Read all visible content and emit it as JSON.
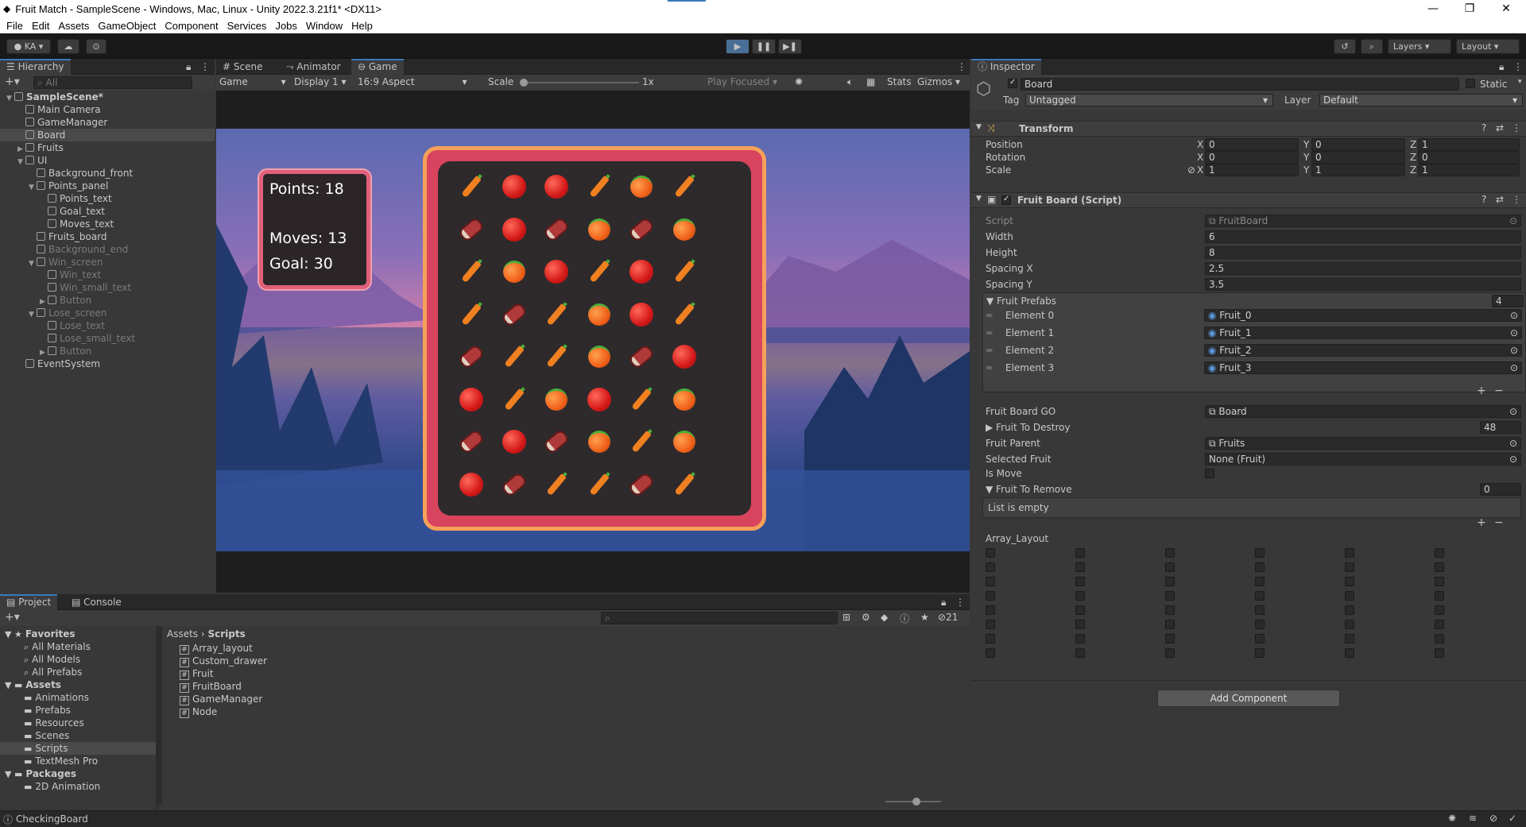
{
  "window": {
    "title": "Fruit Match - SampleScene - Windows, Mac, Linux - Unity 2022.3.21f1* <DX11>"
  },
  "menu": [
    "File",
    "Edit",
    "Assets",
    "GameObject",
    "Component",
    "Services",
    "Jobs",
    "Window",
    "Help"
  ],
  "toolbar": {
    "account": "KA",
    "layers": "Layers",
    "layout": "Layout"
  },
  "hierarchy": {
    "tab": "Hierarchy",
    "search_placeholder": "All",
    "items": [
      {
        "label": "SampleScene*",
        "indent": 0,
        "arrow": "▼",
        "dim": false
      },
      {
        "label": "Main Camera",
        "indent": 1,
        "arrow": "",
        "dim": false
      },
      {
        "label": "GameManager",
        "indent": 1,
        "arrow": "",
        "dim": false
      },
      {
        "label": "Board",
        "indent": 1,
        "arrow": "",
        "dim": false
      },
      {
        "label": "Fruits",
        "indent": 1,
        "arrow": "▶",
        "dim": false
      },
      {
        "label": "UI",
        "indent": 1,
        "arrow": "▼",
        "dim": false
      },
      {
        "label": "Background_front",
        "indent": 2,
        "arrow": "",
        "dim": false
      },
      {
        "label": "Points_panel",
        "indent": 2,
        "arrow": "▼",
        "dim": false
      },
      {
        "label": "Points_text",
        "indent": 3,
        "arrow": "",
        "dim": false
      },
      {
        "label": "Goal_text",
        "indent": 3,
        "arrow": "",
        "dim": false
      },
      {
        "label": "Moves_text",
        "indent": 3,
        "arrow": "",
        "dim": false
      },
      {
        "label": "Fruits_board",
        "indent": 2,
        "arrow": "",
        "dim": false
      },
      {
        "label": "Background_end",
        "indent": 2,
        "arrow": "",
        "dim": true
      },
      {
        "label": "Win_screen",
        "indent": 2,
        "arrow": "▼",
        "dim": true
      },
      {
        "label": "Win_text",
        "indent": 3,
        "arrow": "",
        "dim": true
      },
      {
        "label": "Win_small_text",
        "indent": 3,
        "arrow": "",
        "dim": true
      },
      {
        "label": "Button",
        "indent": 3,
        "arrow": "▶",
        "dim": true
      },
      {
        "label": "Lose_screen",
        "indent": 2,
        "arrow": "▼",
        "dim": true
      },
      {
        "label": "Lose_text",
        "indent": 3,
        "arrow": "",
        "dim": true
      },
      {
        "label": "Lose_small_text",
        "indent": 3,
        "arrow": "",
        "dim": true
      },
      {
        "label": "Button",
        "indent": 3,
        "arrow": "▶",
        "dim": true
      },
      {
        "label": "EventSystem",
        "indent": 1,
        "arrow": "",
        "dim": false
      }
    ]
  },
  "scene_tabs": {
    "scene": "Scene",
    "animator": "Animator",
    "game": "Game"
  },
  "game_bar": {
    "game": "Game",
    "display": "Display 1",
    "aspect": "16:9 Aspect",
    "scale_label": "Scale",
    "scale_value": "1x",
    "play_focused": "Play Focused",
    "stats": "Stats",
    "gizmos": "Gizmos"
  },
  "game_view": {
    "points": "Points: 18",
    "moves": "Moves: 13",
    "goal": "Goal: 30",
    "grid": [
      [
        "carrot",
        "apple",
        "apple",
        "carrot",
        "orange",
        "carrot"
      ],
      [
        "meat",
        "apple",
        "meat",
        "orange",
        "meat",
        "orange"
      ],
      [
        "carrot",
        "orange",
        "apple",
        "carrot",
        "apple",
        "carrot"
      ],
      [
        "carrot",
        "meat",
        "carrot",
        "orange",
        "apple",
        "carrot"
      ],
      [
        "meat",
        "carrot",
        "carrot",
        "orange",
        "meat",
        "apple"
      ],
      [
        "apple",
        "carrot",
        "orange",
        "apple",
        "carrot",
        "orange"
      ],
      [
        "meat",
        "apple",
        "meat",
        "orange",
        "carrot",
        "orange"
      ],
      [
        "apple",
        "meat",
        "carrot",
        "carrot",
        "meat",
        "carrot"
      ]
    ]
  },
  "inspector": {
    "tab": "Inspector",
    "object_name": "Board",
    "static": "Static",
    "tag_label": "Tag",
    "tag_value": "Untagged",
    "layer_label": "Layer",
    "layer_value": "Default",
    "transform": {
      "title": "Transform",
      "position": {
        "label": "Position",
        "x": "0",
        "y": "0",
        "z": "1"
      },
      "rotation": {
        "label": "Rotation",
        "x": "0",
        "y": "0",
        "z": "0"
      },
      "scale": {
        "label": "Scale",
        "x": "1",
        "y": "1",
        "z": "1"
      }
    },
    "script_comp": {
      "title": "Fruit Board (Script)",
      "script_label": "Script",
      "script_value": "FruitBoard",
      "width_label": "Width",
      "width": "6",
      "height_label": "Height",
      "height": "8",
      "spx_label": "Spacing X",
      "spx": "2.5",
      "spy_label": "Spacing Y",
      "spy": "3.5",
      "prefabs_label": "Fruit Prefabs",
      "prefabs_count": "4",
      "elements": [
        {
          "label": "Element 0",
          "value": "Fruit_0"
        },
        {
          "label": "Element 1",
          "value": "Fruit_1"
        },
        {
          "label": "Element 2",
          "value": "Fruit_2"
        },
        {
          "label": "Element 3",
          "value": "Fruit_3"
        }
      ],
      "board_go_label": "Fruit Board GO",
      "board_go": "Board",
      "destroy_label": "Fruit To Destroy",
      "destroy_count": "48",
      "parent_label": "Fruit Parent",
      "parent": "Fruits",
      "selected_label": "Selected Fruit",
      "selected": "None (Fruit)",
      "ismove_label": "Is Move",
      "remove_label": "Fruit To Remove",
      "remove_count": "0",
      "list_empty": "List is empty",
      "array_label": "Array_Layout"
    },
    "add_component": "Add Component"
  },
  "project": {
    "tab_project": "Project",
    "tab_console": "Console",
    "hidden_count": "21",
    "tree": [
      {
        "label": "Favorites",
        "indent": 0,
        "bold": true
      },
      {
        "label": "All Materials",
        "indent": 1
      },
      {
        "label": "All Models",
        "indent": 1
      },
      {
        "label": "All Prefabs",
        "indent": 1
      },
      {
        "label": "Assets",
        "indent": 0,
        "bold": true
      },
      {
        "label": "Animations",
        "indent": 1
      },
      {
        "label": "Prefabs",
        "indent": 1
      },
      {
        "label": "Resources",
        "indent": 1
      },
      {
        "label": "Scenes",
        "indent": 1
      },
      {
        "label": "Scripts",
        "indent": 1
      },
      {
        "label": "TextMesh Pro",
        "indent": 1
      },
      {
        "label": "Packages",
        "indent": 0,
        "bold": true
      },
      {
        "label": "2D Animation",
        "indent": 1
      }
    ],
    "breadcrumb": [
      "Assets",
      "Scripts"
    ],
    "files": [
      "Array_layout",
      "Custom_drawer",
      "Fruit",
      "FruitBoard",
      "GameManager",
      "Node"
    ]
  },
  "status": {
    "text": "CheckingBoard"
  }
}
